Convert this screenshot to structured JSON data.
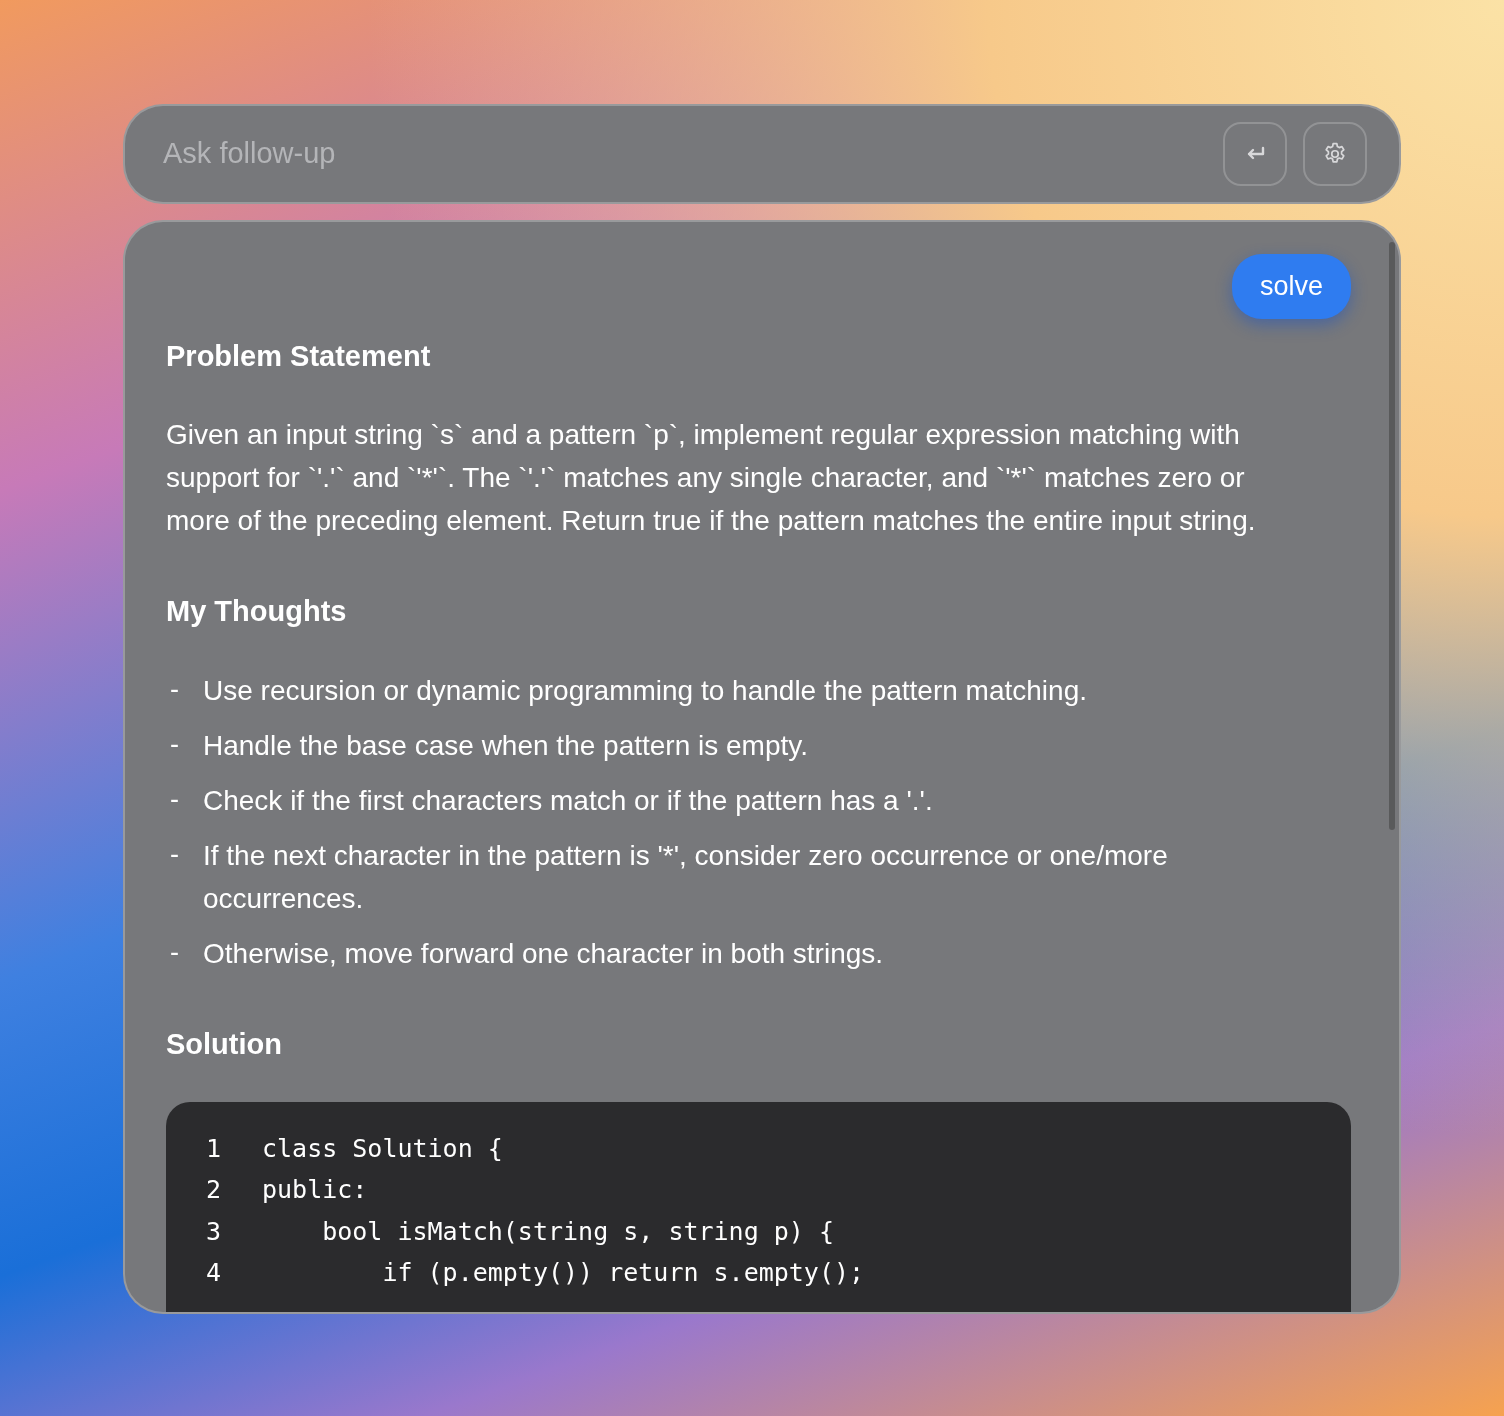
{
  "followup": {
    "placeholder": "Ask follow-up"
  },
  "solve_button": "solve",
  "sections": [
    {
      "kind": "paragraph",
      "heading": "Problem Statement",
      "text": "Given an input string `s` and a pattern `p`, implement regular expression matching with support for `'.'` and `'*'`. The `'.'` matches any single character, and `'*'` matches zero or more of the preceding element. Return true if the pattern matches the entire input string."
    },
    {
      "kind": "list",
      "heading": "My Thoughts",
      "items": [
        {
          "marker": "-",
          "text": "Use recursion or dynamic programming to handle the pattern matching."
        },
        {
          "marker": "-",
          "text": "Handle the base case when the pattern is empty."
        },
        {
          "marker": "-",
          "text": "Check if the first characters match or if the pattern has a '.'."
        },
        {
          "marker": "-",
          "text": "If the next character in the pattern is '*', consider zero occurrence or one/more occurrences."
        },
        {
          "marker": "-",
          "text": "Otherwise, move forward one character in both strings."
        }
      ]
    },
    {
      "kind": "code",
      "heading": "Solution",
      "lines": [
        {
          "number": "1",
          "code": "class Solution {"
        },
        {
          "number": "2",
          "code": "public:"
        },
        {
          "number": "3",
          "code": "    bool isMatch(string s, string p) {"
        },
        {
          "number": "4",
          "code": "        if (p.empty()) return s.empty();"
        }
      ]
    }
  ]
}
